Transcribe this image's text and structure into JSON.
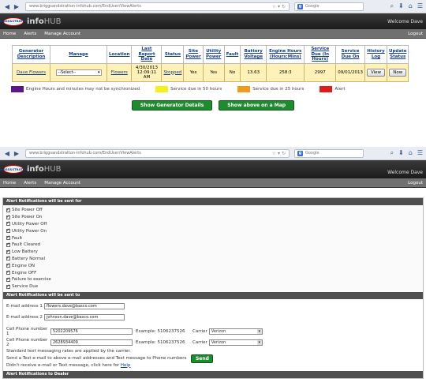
{
  "browser": {
    "url": "www.briggsandstratton-infohub.com/EndUser/ViewAlerts",
    "search_placeholder": "Google",
    "search_engine": "g"
  },
  "app": {
    "brand_logo": "BRIGGS&STRATTON",
    "product_name_bold": "info",
    "product_name_light": "HUB",
    "welcome": "Welcome Dave",
    "menu": [
      "Home",
      "Alerts",
      "Manage Account"
    ],
    "logout": "Logout"
  },
  "generator_table": {
    "headers": [
      "Generator Description",
      "Manage",
      "Location",
      "Last Report Date",
      "Status",
      "Site Power",
      "Utility Power",
      "Fault",
      "Battery Voltage",
      "Engine Hours (Hours:Mins)",
      "Service Due (In Hours)",
      "Service Due On",
      "History Log",
      "Update Status"
    ],
    "row": {
      "description": "Dave Flowers",
      "manage": "--Select--",
      "location": "Flowers",
      "last_report_line1": "4/30/2013",
      "last_report_line2": "12:09:11 AM",
      "status": "Stopped",
      "site_power": "Yes",
      "utility_power": "Yes",
      "fault": "No",
      "battery_voltage": "13.63",
      "engine_hours": "258:3",
      "service_due_hours": "2997",
      "service_due_on": "09/01/2013",
      "history_btn": "View",
      "update_btn": "Now"
    }
  },
  "legend": [
    {
      "label": "Engine Hours and minutes may not be synchronized",
      "color": "#5a168a"
    },
    {
      "label": "Service due in 50 hours",
      "color": "#f4f01c"
    },
    {
      "label": "Service due in 25 hours",
      "color": "#f29a1c"
    },
    {
      "label": "Alert",
      "color": "#e11a1a"
    }
  ],
  "buttons": {
    "show_details": "Show Generator Details",
    "show_map": "Show above on a Map"
  },
  "alerts_page": {
    "sent_for_header": "Alert Notifications will be sent for",
    "sent_for_items": [
      "Site Power Off",
      "Site Power On",
      "Utility Power Off",
      "Utility Power On",
      "Fault",
      "Fault Cleared",
      "Low Battery",
      "Battery Normal",
      "Engine ON",
      "Engine OFF",
      "Failure to exercise",
      "Service Due"
    ],
    "sent_to_header": "Alert Notifications will be sent to",
    "email1_label": "E-mail address 1",
    "email1_value": "flowers.dave@basco.com",
    "email2_label": "E-mail address 2",
    "email2_value": "johnson.dave@basco.com",
    "cell1_label": "Cell Phone number 1",
    "cell1_value": "5202209576",
    "cell2_label": "Cell Phone number 2",
    "cell2_value": "2628934409",
    "example_label": "Example: 5106237526",
    "carrier_label": "Carrier",
    "carrier1": "Verizon",
    "carrier2": "Verizon",
    "note_rates": "Standard text messaging rates are applied by the carrier.",
    "note_send": "Send a Test e-mail to above e-mail addresses and Text message to Phone numbers",
    "send_btn": "Send",
    "note_help_prefix": "Didn't receive e-mail or Text message, click here for ",
    "note_help_link": "Help",
    "dealer_header": "Alert Notifications to Dealer"
  }
}
